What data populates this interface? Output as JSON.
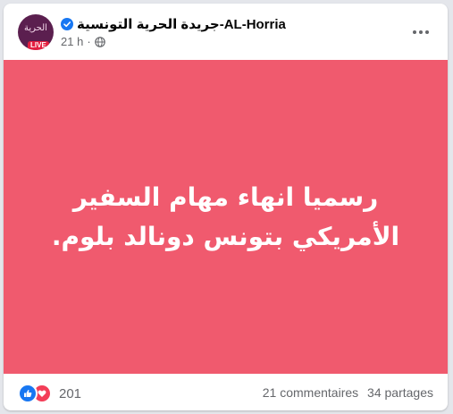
{
  "post": {
    "page_name": "جريدة الحرية التونسية-AL-Horria",
    "timestamp": "21 h",
    "separator": "·",
    "avatar_badge": "LIVE",
    "avatar_logo_text": "الحرية",
    "body_text": "رسميا انهاء مهام السفير الأمريكي بتونس دونالد بلوم.",
    "background_color": "#f05a6e",
    "reaction_count": "201",
    "comments": "21 commentaires",
    "shares": "34 partages"
  },
  "icons": {
    "verified": "verified-badge-icon",
    "privacy": "globe-icon",
    "more": "more-options-icon",
    "like": "like-reaction-icon",
    "love": "love-reaction-icon"
  },
  "colors": {
    "facebook_blue": "#1877f2",
    "love_red": "#f33e58",
    "secondary_text": "#65676b"
  }
}
